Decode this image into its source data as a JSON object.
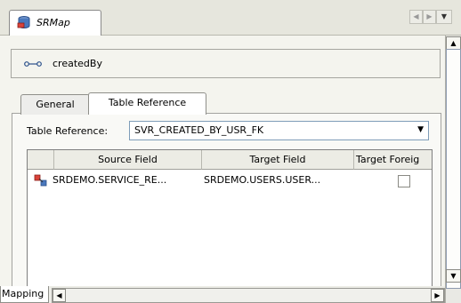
{
  "editor_tab": {
    "title": "SRMap"
  },
  "name_box": {
    "name": "createdBy"
  },
  "tabs": {
    "general": "General",
    "table_reference": "Table Reference"
  },
  "table_reference": {
    "label": "Table Reference:",
    "value": "SVR_CREATED_BY_USR_FK"
  },
  "grid": {
    "columns": [
      "Source Field",
      "Target Field",
      "Target Foreig"
    ],
    "rows": [
      {
        "source": "SRDEMO.SERVICE_RE...",
        "target": "SRDEMO.USERS.USER...",
        "target_foreign": false
      }
    ]
  },
  "bottom": {
    "mapping_tab": "Mapping"
  },
  "colors": {
    "accent": "#3a6ea5",
    "tab_bg": "#e6e6dd",
    "panel_bg": "#f4f4ee"
  },
  "icons": [
    "database-icon",
    "attribute-icon",
    "relationship-icon"
  ]
}
